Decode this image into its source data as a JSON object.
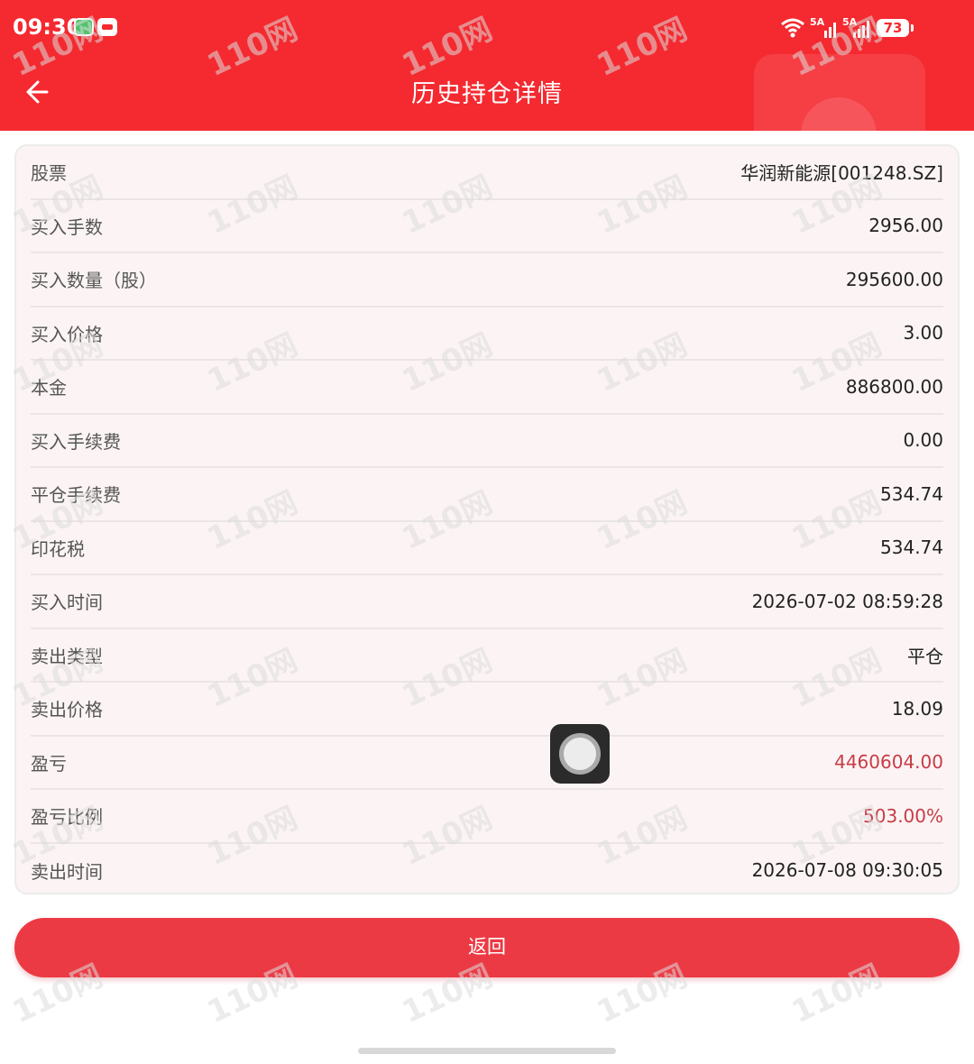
{
  "status_bar": {
    "time": "09:30",
    "signal_1_label": "5A",
    "signal_2_label": "5A",
    "battery_level": "73"
  },
  "header": {
    "title": "历史持仓详情",
    "back_icon": "arrow-left-icon"
  },
  "details": [
    {
      "label": "股票",
      "value": "华润新能源[001248.SZ]"
    },
    {
      "label": "买入手数",
      "value": "2956.00"
    },
    {
      "label": "买入数量（股）",
      "value": "295600.00"
    },
    {
      "label": "买入价格",
      "value": "3.00"
    },
    {
      "label": "本金",
      "value": "886800.00"
    },
    {
      "label": "买入手续费",
      "value": "0.00"
    },
    {
      "label": "平仓手续费",
      "value": "534.74"
    },
    {
      "label": "印花税",
      "value": "534.74"
    },
    {
      "label": "买入时间",
      "value": "2026-07-02 08:59:28"
    },
    {
      "label": "卖出类型",
      "value": "平仓"
    },
    {
      "label": "卖出价格",
      "value": "18.09"
    },
    {
      "label": "盈亏",
      "value": "4460604.00"
    },
    {
      "label": "盈亏比例",
      "value": "503.00%"
    },
    {
      "label": "卖出时间",
      "value": "2026-07-08 09:30:05"
    }
  ],
  "return_button_label": "返回",
  "watermark_text": "110网",
  "colors": {
    "header": "#f42a30",
    "button": "#ec3a44",
    "profit_text": "#c83b46",
    "card_bg": "#fcf4f4"
  }
}
